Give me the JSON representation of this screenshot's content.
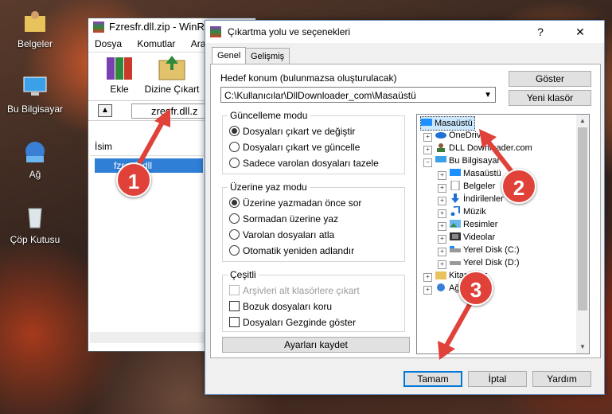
{
  "desktop": {
    "icons": [
      {
        "label": "Belgeler"
      },
      {
        "label": "Bu Bilgisayar"
      },
      {
        "label": "Ağ"
      },
      {
        "label": "Çöp Kutusu"
      }
    ]
  },
  "winrar": {
    "title": "Fzresfr.dll.zip - WinR",
    "menu": [
      "Dosya",
      "Komutlar",
      "Araçla"
    ],
    "tools": {
      "add_label": "Ekle",
      "extract_label": "Dizine Çıkart"
    },
    "path": "zresfr.dll.z",
    "column_name": "İsim",
    "file_row": "fzresfr.dll"
  },
  "dialog": {
    "title": "Çıkartma yolu ve seçenekleri",
    "help_btn": "?",
    "close_btn": "✕",
    "tabs": [
      "Genel",
      "Gelişmiş"
    ],
    "dest_label": "Hedef konum (bulunmazsa oluşturulacak)",
    "dest_value": "C:\\Kullanıcılar\\DllDownloader_com\\Masaüstü",
    "show_btn": "Göster",
    "new_folder_btn": "Yeni klasör",
    "update_group": {
      "title": "Güncelleme modu",
      "options": [
        "Dosyaları çıkart ve değiştir",
        "Dosyaları çıkart ve güncelle",
        "Sadece varolan dosyaları tazele"
      ],
      "selected": 0
    },
    "overwrite_group": {
      "title": "Üzerine yaz modu",
      "options": [
        "Üzerine yazmadan önce sor",
        "Sormadan üzerine yaz",
        "Varolan dosyaları atla",
        "Otomatik yeniden adlandır"
      ],
      "selected": 0
    },
    "misc_group": {
      "title": "Çeşitli",
      "options": [
        "Arşivleri alt klasörlere çıkart",
        "Bozuk dosyaları koru",
        "Dosyaları Gezginde göster"
      ]
    },
    "save_settings_btn": "Ayarları kaydet",
    "tree": [
      {
        "label": "Masaüstü"
      },
      {
        "label": "OneDrive"
      },
      {
        "label": "DLL Downloader.com"
      },
      {
        "label": "Bu Bilgisayar"
      },
      {
        "label": "Masaüstü"
      },
      {
        "label": "Belgeler"
      },
      {
        "label": "İndirilenler"
      },
      {
        "label": "Müzik"
      },
      {
        "label": "Resimler"
      },
      {
        "label": "Videolar"
      },
      {
        "label": "Yerel Disk (C:)"
      },
      {
        "label": "Yerel Disk (D:)"
      },
      {
        "label": "Kitaplıklar"
      },
      {
        "label": "Ağ"
      }
    ],
    "ok_btn": "Tamam",
    "cancel_btn": "İptal",
    "help_btn2": "Yardım"
  },
  "annotations": {
    "steps": [
      "1",
      "2",
      "3"
    ],
    "color": "#e0423a"
  }
}
